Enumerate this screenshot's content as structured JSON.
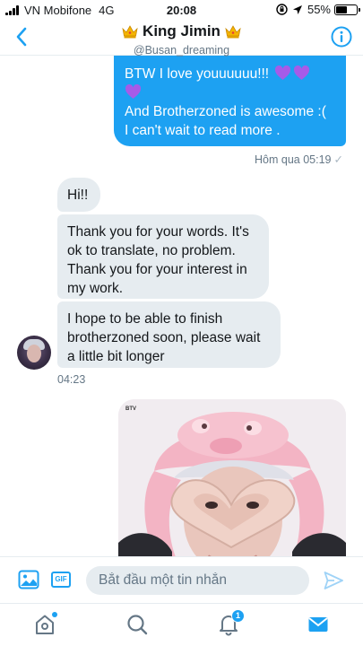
{
  "status_bar": {
    "carrier": "VN Mobifone",
    "network": "4G",
    "time": "20:08",
    "battery": "55%",
    "battery_level": 0.55
  },
  "header": {
    "title": "King Jimin",
    "handle": "@Busan_dreaming"
  },
  "messages": {
    "outgoing": {
      "line1": "BTW I love youuuuuu!!!",
      "line2": "And Brotherzoned is awesome :(",
      "line3": "I can't wait to read more .",
      "timestamp": "Hôm qua 05:19",
      "read_mark": "✓"
    },
    "incoming": [
      {
        "text": "Hi!!"
      },
      {
        "text": "Thank you for your words. It's ok to translate, no problem. Thank you for your interest in my work."
      },
      {
        "text": "I hope to be able to finish brotherzoned soon, please wait a little bit longer"
      }
    ],
    "incoming_timestamp": "04:23",
    "image_tag": "BTV"
  },
  "composer": {
    "placeholder": "Bắt đầu một tin nhắn",
    "gif_label": "GIF"
  },
  "tabbar": {
    "notification_count": "1"
  },
  "colors": {
    "accent": "#1da1f2",
    "incoming_bubble": "#e6ecf0",
    "muted_text": "#657786",
    "heart": "#a65be8"
  }
}
